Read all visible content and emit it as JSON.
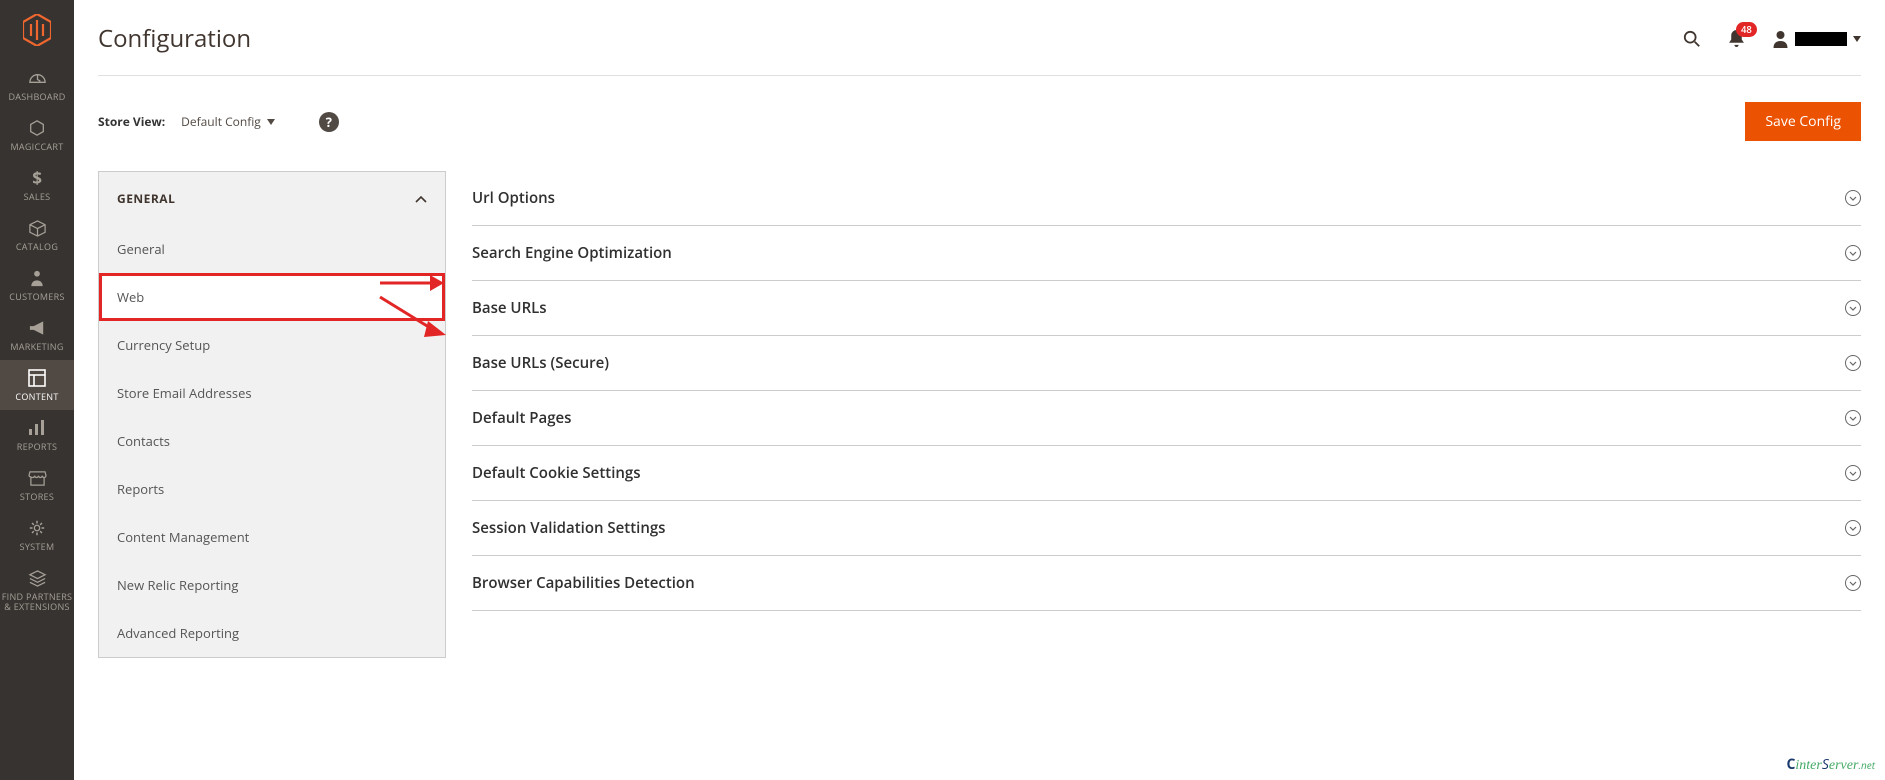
{
  "header": {
    "title": "Configuration",
    "notification_count": "48"
  },
  "toolbar": {
    "store_view_label": "Store View:",
    "scope_value": "Default Config",
    "help_tooltip": "?",
    "save_label": "Save Config"
  },
  "sidenav": {
    "items": [
      {
        "label": "DASHBOARD"
      },
      {
        "label": "MAGICCART"
      },
      {
        "label": "SALES"
      },
      {
        "label": "CATALOG"
      },
      {
        "label": "CUSTOMERS"
      },
      {
        "label": "MARKETING"
      },
      {
        "label": "CONTENT"
      },
      {
        "label": "REPORTS"
      },
      {
        "label": "STORES"
      },
      {
        "label": "SYSTEM"
      },
      {
        "label": "FIND PARTNERS\n& EXTENSIONS"
      }
    ]
  },
  "config_nav": {
    "group_label": "GENERAL",
    "items": [
      {
        "label": "General"
      },
      {
        "label": "Web",
        "selected": true
      },
      {
        "label": "Currency Setup"
      },
      {
        "label": "Store Email Addresses"
      },
      {
        "label": "Contacts"
      },
      {
        "label": "Reports"
      },
      {
        "label": "Content Management"
      },
      {
        "label": "New Relic Reporting"
      },
      {
        "label": "Advanced Reporting"
      }
    ]
  },
  "config_sections": [
    {
      "label": "Url Options"
    },
    {
      "label": "Search Engine Optimization"
    },
    {
      "label": "Base URLs"
    },
    {
      "label": "Base URLs (Secure)"
    },
    {
      "label": "Default Pages"
    },
    {
      "label": "Default Cookie Settings"
    },
    {
      "label": "Session Validation Settings"
    },
    {
      "label": "Browser Capabilities Detection"
    }
  ],
  "watermark": "InterServer.net"
}
